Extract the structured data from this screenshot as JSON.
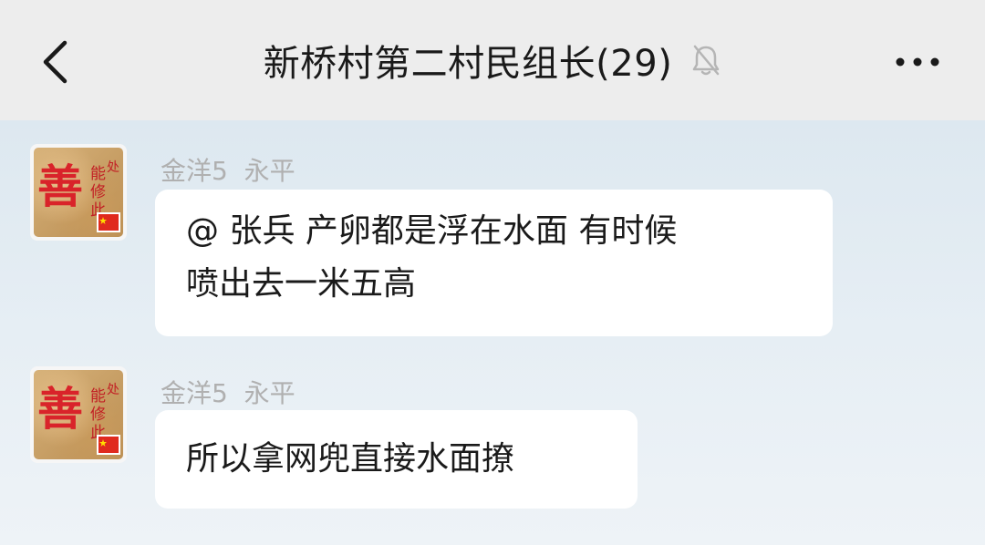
{
  "header": {
    "title": "新桥村第二村民组长(29)",
    "icons": {
      "back": "chevron-left-icon",
      "mute": "bell-muted-icon",
      "more": "more-horizontal-icon"
    }
  },
  "messages": [
    {
      "sender": "金洋5  永平",
      "line1": "@ 张兵  产卵都是浮在水面 有时候",
      "line2": "喷出去一米五高"
    },
    {
      "sender": "金洋5  永平",
      "line1": "所以拿网兜直接水面撩"
    }
  ],
  "avatar": {
    "text": "善能修此处",
    "ink_color": "#d9232a",
    "badge": "china-flag-icon"
  },
  "colors": {
    "header_bg": "#ededed",
    "chat_bg": "#e2ebf2",
    "bubble_bg": "#ffffff",
    "sender_text": "#b0b0b0"
  }
}
